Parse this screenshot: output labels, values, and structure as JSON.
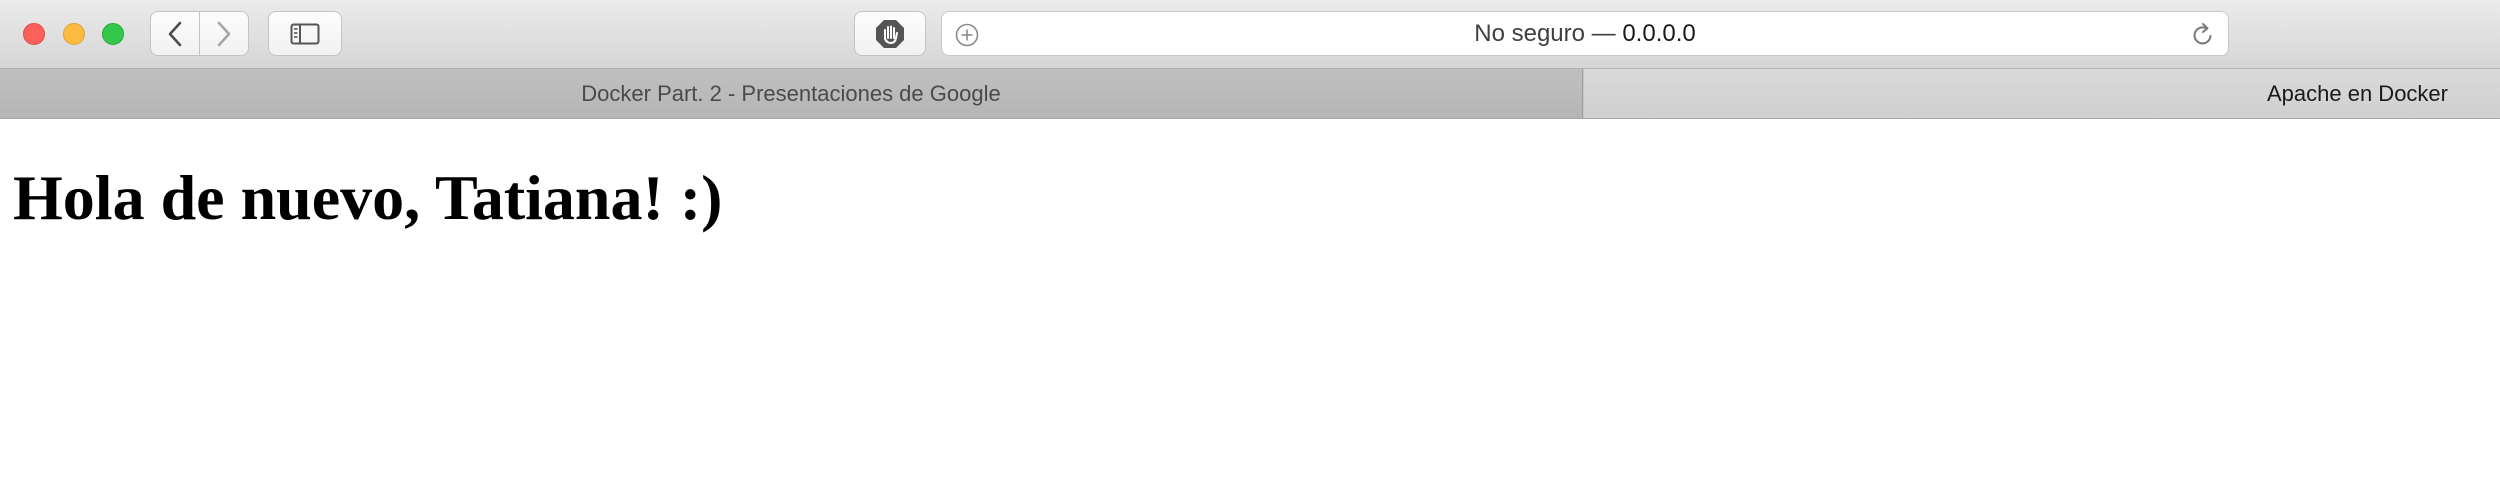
{
  "browser": {
    "address_prefix": "No seguro — ",
    "address_host": "0.0.0.0",
    "icons": {
      "back": "chevron-left-icon",
      "forward": "chevron-right-icon",
      "sidebar": "sidebar-icon",
      "block": "hand-stop-icon",
      "add": "plus-circle-icon",
      "reload": "reload-icon"
    }
  },
  "tabs": [
    {
      "label": "Docker Part. 2 - Presentaciones de Google",
      "active": false
    },
    {
      "label": "Apache en Docker",
      "active": true
    }
  ],
  "page": {
    "heading": "Hola de nuevo, Tatiana! :)"
  }
}
